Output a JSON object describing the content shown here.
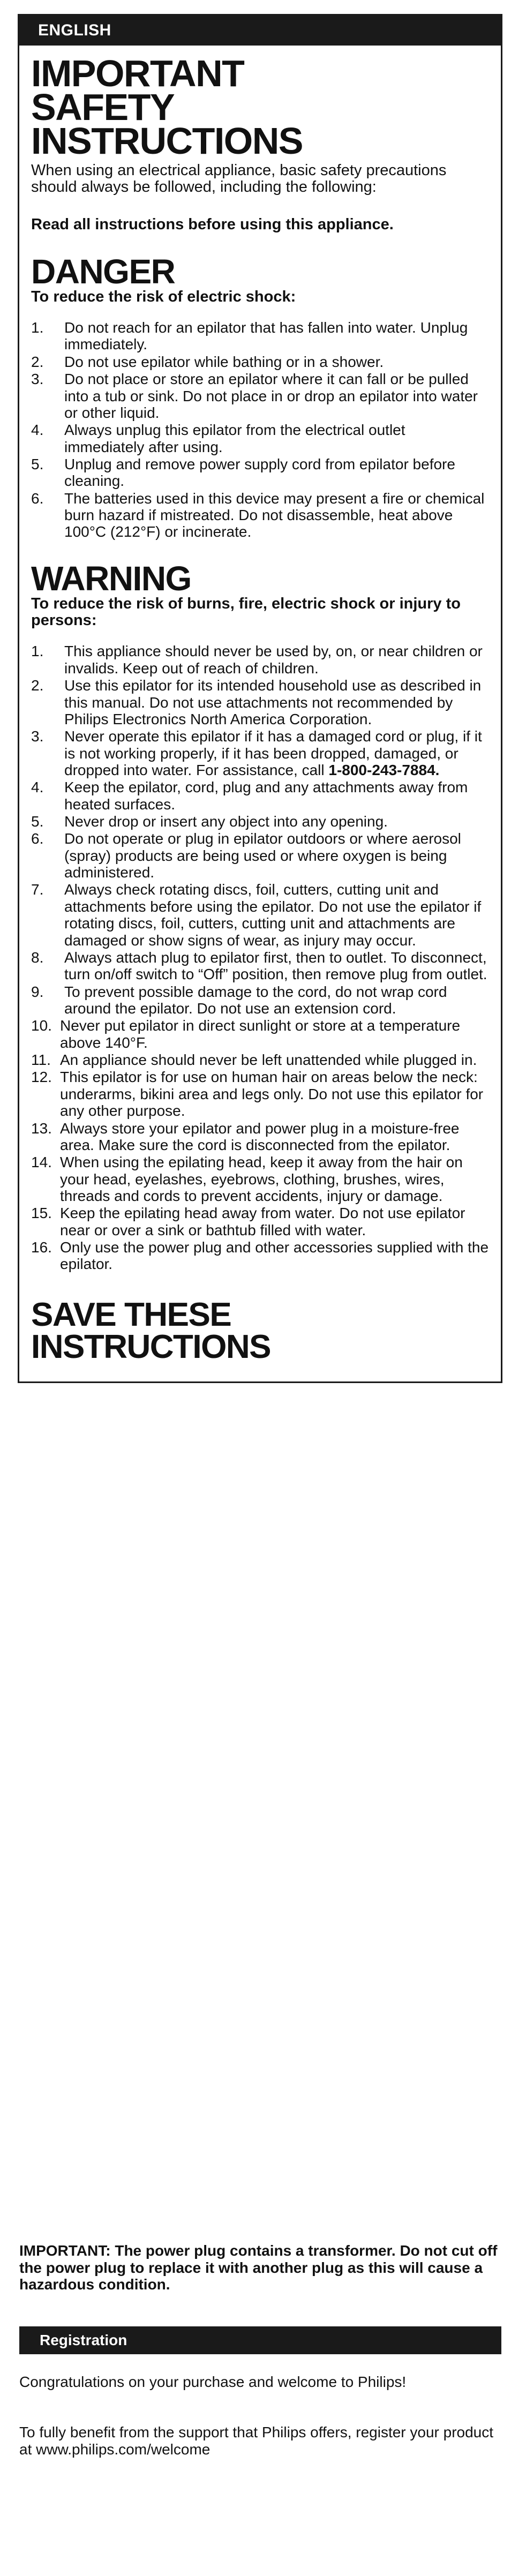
{
  "language_bar": {
    "label": "ENGLISH"
  },
  "title": {
    "lines": [
      "IMPORTANT",
      "SAFETY",
      "INSTRUCTIONS"
    ],
    "intro": "When using an electrical appliance, basic safety precautions should always be followed, including the following:",
    "lead": "Read all instructions before using this appliance."
  },
  "danger": {
    "heading": "DANGER",
    "subheading": "To reduce the risk of electric shock:",
    "items": [
      {
        "num": "1.",
        "text": "Do not reach for an epilator that has fallen into water. Unplug immediately."
      },
      {
        "num": "2.",
        "text": "Do not use epilator while bathing or in a shower."
      },
      {
        "num": "3.",
        "text": "Do not place or store an epilator where it can fall or be pulled into a tub or sink. Do not place in or drop an epilator into water or other liquid."
      },
      {
        "num": "4.",
        "text": "Always unplug this epilator from the electrical outlet immediately after using."
      },
      {
        "num": "5.",
        "text": "Unplug and remove power supply cord from epilator before cleaning."
      },
      {
        "num": "6.",
        "text": "The batteries used in this device may present a fire or chemical burn hazard if mistreated. Do not disassemble, heat above 100°C (212°F) or incinerate."
      }
    ]
  },
  "warning": {
    "heading": "WARNING",
    "subheading": "To reduce the risk of burns, fire, electric shock or injury to persons:",
    "items": [
      {
        "num": "1.",
        "text": "This appliance should never be used by, on, or near children or invalids. Keep out of reach of children."
      },
      {
        "num": "2.",
        "text": "Use this epilator for its intended household use as described in this manual. Do not use attachments not recommended by Philips Electronics North America Corporation."
      },
      {
        "num": "3.",
        "text": "Never operate this epilator if it has a damaged cord or plug, if it is not working properly, if it has been dropped, damaged, or dropped into water. For assistance, call ",
        "bold_tail": "1-800-243-7884."
      },
      {
        "num": "4.",
        "text": "Keep the epilator, cord, plug and any attachments away from heated surfaces."
      },
      {
        "num": "5.",
        "text": "Never drop or insert any object into any opening."
      },
      {
        "num": "6.",
        "text": "Do not operate or plug in epilator outdoors or where aerosol (spray) products are being used or where oxygen is being administered."
      },
      {
        "num": "7.",
        "text": "Always check rotating discs, foil, cutters, cutting unit and attachments before using the epilator. Do not use the epilator if rotating discs, foil, cutters, cutting unit and attachments are damaged or show signs of wear, as injury may occur."
      },
      {
        "num": "8.",
        "text": "Always attach plug to epilator first, then to outlet. To disconnect, turn on/off switch to “Off” position, then remove plug from outlet."
      },
      {
        "num": "9.",
        "text": "To prevent possible damage to the cord, do not wrap cord around the epilator. Do not use an extension cord."
      },
      {
        "num": "10.",
        "text": "Never put epilator in direct sunlight or store at a temperature above 140°F."
      },
      {
        "num": "11.",
        "text": "An appliance should never be left unattended while plugged in."
      },
      {
        "num": "12.",
        "text": "This epilator is for use on human hair on areas below the neck: underarms, bikini area and legs only. Do not use this epilator for any other purpose."
      },
      {
        "num": "13.",
        "text": "Always store your epilator and power plug in a moisture-free area. Make sure the cord is disconnected from the epilator."
      },
      {
        "num": "14.",
        "text": "When using the epilating head, keep it away from the hair on your head, eyelashes, eyebrows, clothing, brushes, wires, threads and cords to prevent accidents, injury or damage."
      },
      {
        "num": "15.",
        "text": "Keep the epilating head away from water. Do not use epilator near or over a sink or bathtub filled with water."
      },
      {
        "num": "16.",
        "text": "Only use the power plug and other accessories supplied with the epilator."
      }
    ]
  },
  "save": {
    "lines": [
      "SAVE THESE",
      "INSTRUCTIONS"
    ]
  },
  "important_note": {
    "text": "IMPORTANT: The power plug contains a transformer.  Do not cut off the power plug to replace it with another plug as this will cause a hazardous condition."
  },
  "registration": {
    "bar_label": "Registration",
    "paragraph_1": "Congratulations on your purchase and welcome to Philips!",
    "paragraph_2": "To fully benefit from the support that Philips offers, register your product at www.philips.com/welcome"
  },
  "colors": {
    "ink": "#111111",
    "bar_background": "#1a1a1a",
    "bar_text": "#ffffff",
    "page_background": "#ffffff"
  }
}
